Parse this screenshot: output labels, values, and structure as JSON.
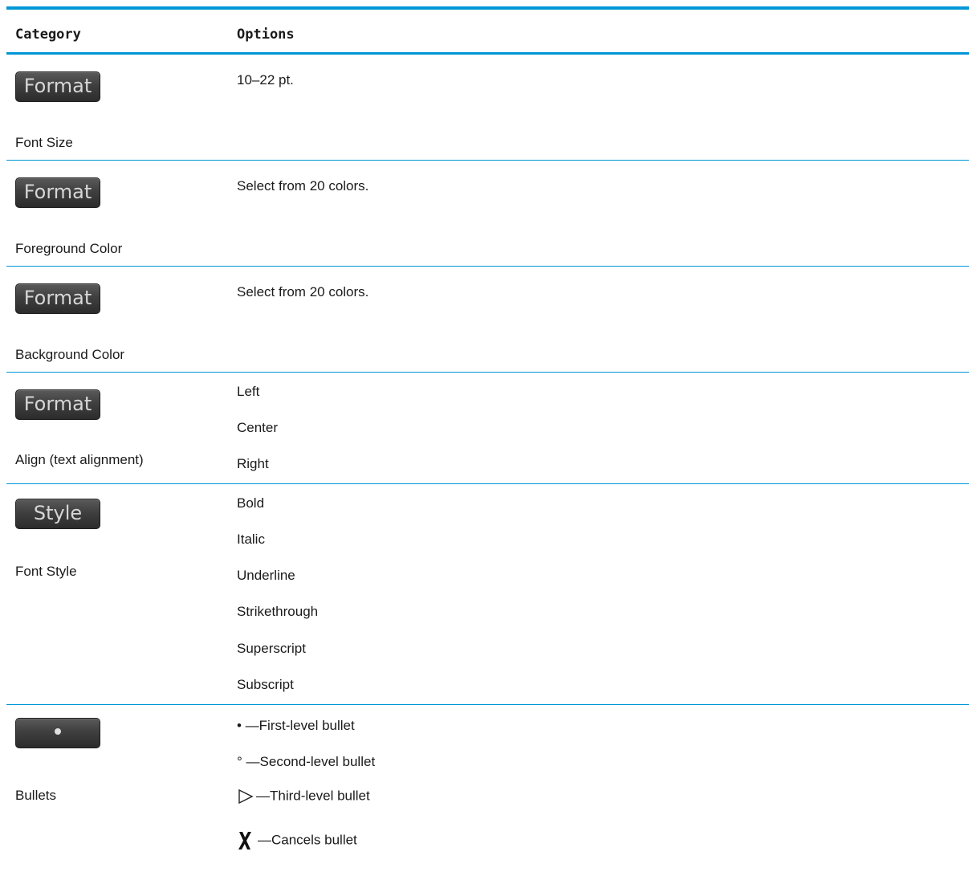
{
  "header": {
    "category": "Category",
    "options": "Options"
  },
  "rows": [
    {
      "key": "Format",
      "label": "Font Size",
      "options": [
        "10–22 pt."
      ]
    },
    {
      "key": "Format",
      "label": "Foreground Color",
      "options": [
        "Select from 20 colors."
      ]
    },
    {
      "key": "Format",
      "label": "Background Color",
      "options": [
        "Select from 20 colors."
      ]
    },
    {
      "key": "Format",
      "label": "Align (text alignment)",
      "options": [
        "Left",
        "Center",
        "Right"
      ]
    },
    {
      "key": "Style",
      "label": "Font Style",
      "options": [
        "Bold",
        "Italic",
        "Underline",
        "Strikethrough",
        "Superscript",
        "Subscript"
      ]
    },
    {
      "key": "•",
      "label": "Bullets",
      "options": [
        "• —First-level bullet",
        "° —Second-level bullet",
        "—Third-level bullet",
        "—Cancels bullet"
      ]
    }
  ],
  "colors": {
    "rule": "#0096d6",
    "softkey": "#3f3f3f"
  },
  "icons": [
    "triangle-icon",
    "x-mark-icon"
  ]
}
